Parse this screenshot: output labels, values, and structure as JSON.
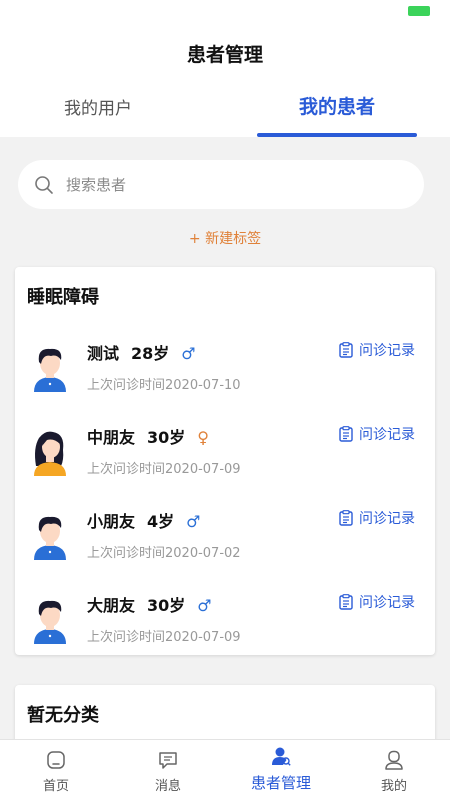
{
  "header": {
    "title": "患者管理",
    "tabs": [
      {
        "label": "我的用户",
        "active": false
      },
      {
        "label": "我的患者",
        "active": true
      }
    ]
  },
  "search": {
    "placeholder": "搜索患者"
  },
  "new_tag": {
    "label": "+ 新建标签"
  },
  "groups": [
    {
      "title": "睡眠障碍",
      "patients": [
        {
          "name": "测试",
          "age": "28岁",
          "gender": "♂",
          "last_visit": "上次问诊时间2020-07-10",
          "record_label": "问诊记录"
        },
        {
          "name": "中朋友",
          "age": "30岁",
          "gender": "♀",
          "last_visit": "上次问诊时间2020-07-09",
          "record_label": "问诊记录"
        },
        {
          "name": "小朋友",
          "age": "4岁",
          "gender": "♂",
          "last_visit": "上次问诊时间2020-07-02",
          "record_label": "问诊记录"
        },
        {
          "name": "大朋友",
          "age": "30岁",
          "gender": "♂",
          "last_visit": "上次问诊时间2020-07-09",
          "record_label": "问诊记录"
        }
      ]
    },
    {
      "title": "暂无分类",
      "patients": []
    }
  ],
  "bottom_nav": [
    {
      "label": "首页",
      "icon": "home-icon",
      "active": false
    },
    {
      "label": "消息",
      "icon": "message-icon",
      "active": false
    },
    {
      "label": "患者管理",
      "icon": "patient-manage-icon",
      "active": true
    },
    {
      "label": "我的",
      "icon": "profile-icon",
      "active": false
    }
  ],
  "colors": {
    "accent": "#2a5bd7",
    "tag": "#e0823a",
    "male": "#2a6fd6",
    "female": "#e0823a",
    "battery": "#3bd35a"
  }
}
